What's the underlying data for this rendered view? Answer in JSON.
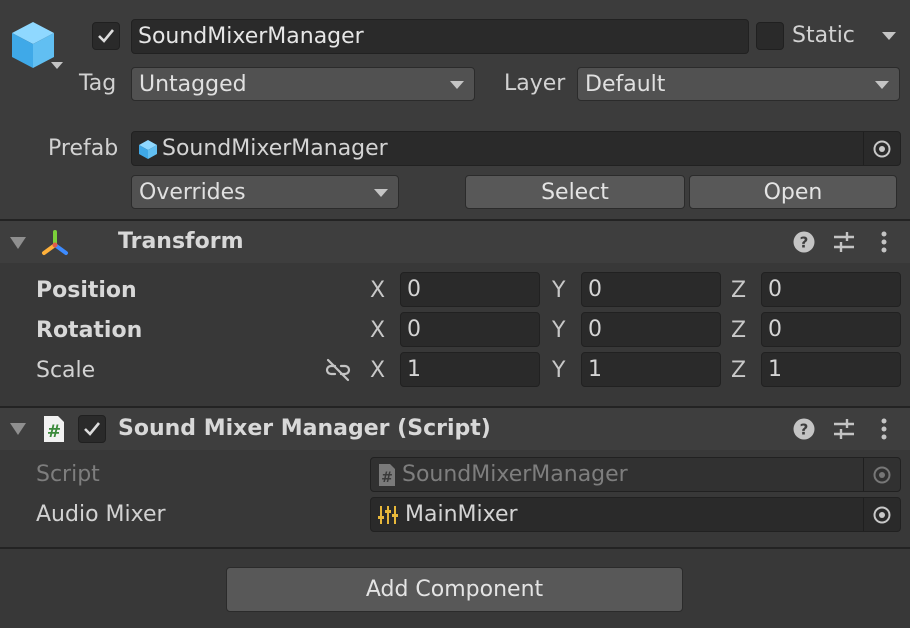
{
  "object": {
    "name": "SoundMixerManager",
    "active": true,
    "static_label": "Static",
    "tag_label": "Tag",
    "tag_value": "Untagged",
    "layer_label": "Layer",
    "layer_value": "Default"
  },
  "prefab": {
    "label": "Prefab",
    "value": "SoundMixerManager",
    "overrides_label": "Overrides",
    "select_label": "Select",
    "open_label": "Open"
  },
  "transform": {
    "title": "Transform",
    "rows": [
      {
        "label": "Position",
        "x": "0",
        "y": "0",
        "z": "0"
      },
      {
        "label": "Rotation",
        "x": "0",
        "y": "0",
        "z": "0"
      },
      {
        "label": "Scale",
        "x": "1",
        "y": "1",
        "z": "1"
      }
    ],
    "axis_x": "X",
    "axis_y": "Y",
    "axis_z": "Z"
  },
  "script_component": {
    "title": "Sound Mixer Manager (Script)",
    "enabled": true,
    "script_label": "Script",
    "script_value": "SoundMixerManager",
    "audio_mixer_label": "Audio Mixer",
    "audio_mixer_value": "MainMixer"
  },
  "add_component_label": "Add Component",
  "icons": {
    "object": "cube-icon",
    "transform": "transform-axes-icon",
    "script": "csharp-script-icon",
    "mixer": "audio-mixer-icon",
    "help": "help-icon",
    "presets": "presets-icon",
    "menu": "kebab-menu-icon",
    "constrain": "unlinked-scale-icon",
    "picker": "object-picker-icon"
  }
}
